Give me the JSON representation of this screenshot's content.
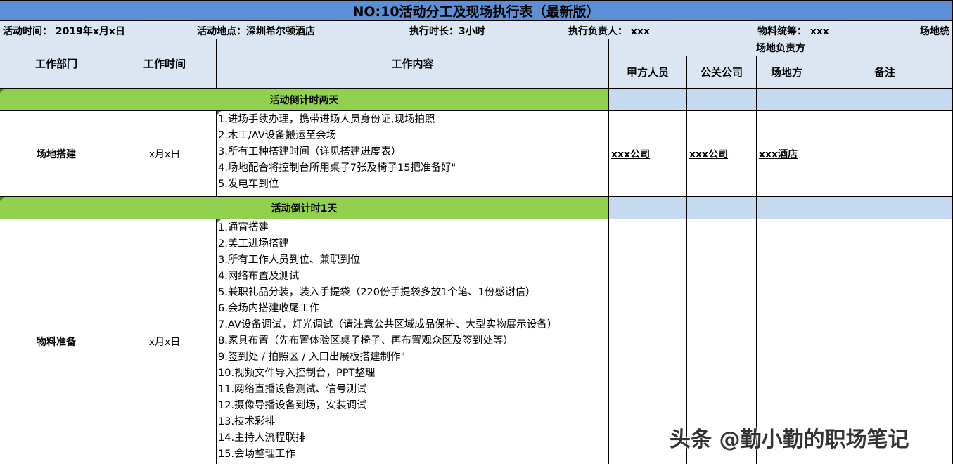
{
  "title": "NO:10活动分工及现场执行表（最新版）",
  "info": {
    "time": "活动时间：  2019年x月x日",
    "place": "活动地点：深圳希尔顿酒店",
    "duration": "执行时长：3小时",
    "manager": "执行负责人：  xxx",
    "material": "物料统筹：  xxx",
    "venue": "场地统"
  },
  "headers": {
    "dept": "工作部门",
    "time": "工作时间",
    "content": "工作内容",
    "venue_group": "场地负责方",
    "party_a": "甲方人员",
    "pr": "公关公司",
    "venue": "场地方",
    "note": "备注"
  },
  "sections": [
    {
      "banner": "活动倒计时两天",
      "dept": "场地搭建",
      "time": "x月x日",
      "items": [
        "1.进场手续办理，携带进场人员身份证,现场拍照",
        "2.木工/AV设备搬运至会场",
        "3.所有工种搭建时间（详见搭建进度表）",
        "4.场地配合将控制台所用桌子7张及椅子15把准备好\"",
        "5.发电车到位"
      ],
      "party_a": "xxx公司",
      "pr": "xxx公司",
      "venue": "xxx酒店"
    },
    {
      "banner": "活动倒计时1天",
      "dept": "物料准备",
      "time": "x月x日",
      "items": [
        "1.通宵搭建",
        "2.美工进场搭建",
        "3.所有工作人员到位、兼职到位",
        "4.网络布置及测试",
        "5.兼职礼品分装，装入手提袋（220份手提袋多放1个笔、1份感谢信）",
        "6.会场内搭建收尾工作",
        "7.AV设备调试，灯光调试（请注意公共区域成品保护、大型实物展示设备）",
        "8.家具布置（先布置体验区桌子椅子、再布置观众区及签到处等）",
        "9.签到处 / 拍照区 / 入口出展板搭建制作\"",
        "10.视频文件导入控制台，PPT整理",
        "11.网络直播设备测试、信号测试",
        "12.摄像导播设备到场，安装调试",
        "13.技术彩排",
        "14.主持人流程联排",
        "15.会场整理工作"
      ],
      "party_a": "",
      "pr": "",
      "venue": ""
    }
  ],
  "watermark": "头条 @勤小勤的职场笔记"
}
